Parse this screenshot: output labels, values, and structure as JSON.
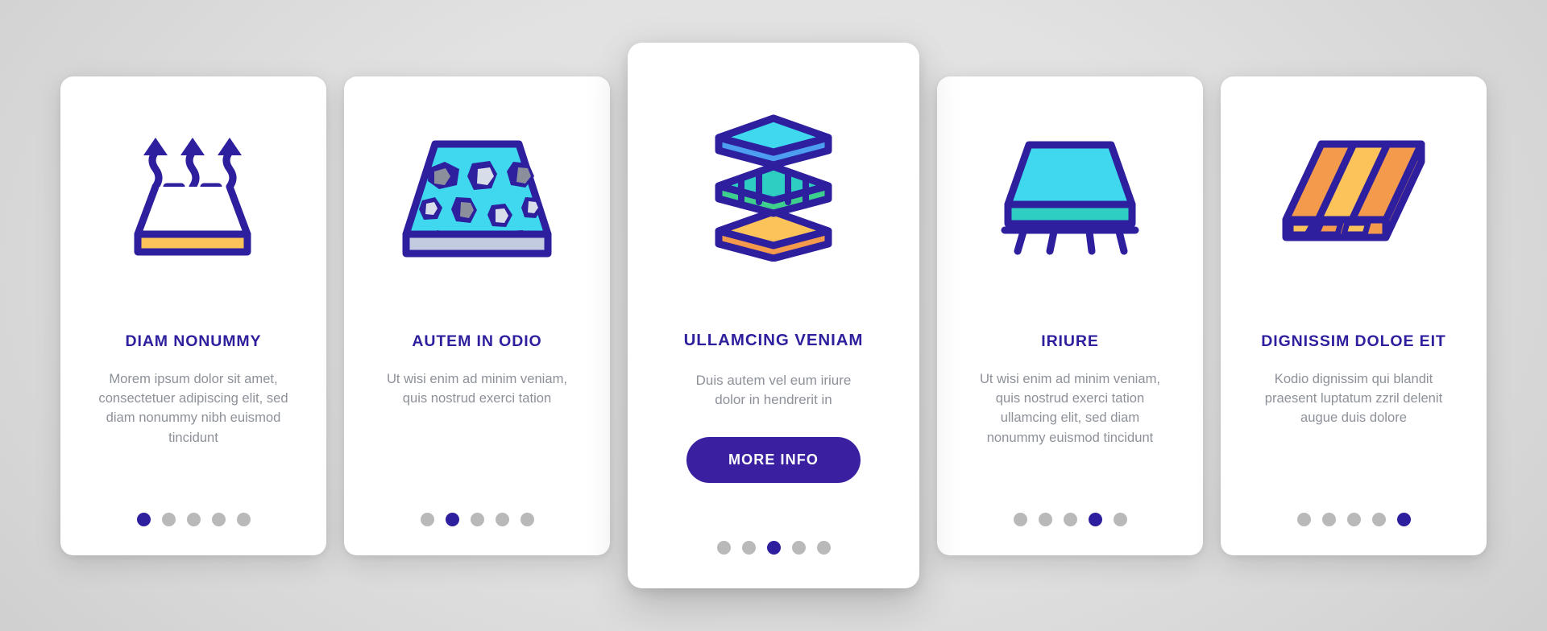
{
  "theme": {
    "accent_purple": "#2d1f9e",
    "button_purple": "#3a1fa0",
    "cyan": "#3fd8ef",
    "teal": "#2ecfc2",
    "green": "#3ccf8e",
    "blue": "#4d9ef0",
    "orange": "#f49a4c",
    "yellow": "#fcc35a",
    "gray_text": "#8d9199",
    "dot_inactive": "#b9b9b9",
    "slab_gray": "#c3cbe0",
    "chip_gray": "#8a8f9b",
    "chip_light": "#d8ddea",
    "background": "#e2e2e2"
  },
  "cards": [
    {
      "id": "card-1",
      "icon_name": "breathable-slab-icon",
      "title": "DIAM NONUMMY",
      "body": "Morem ipsum dolor sit amet, consectetuer adipiscing elit, sed diam nonummy nibh euismod tincidunt",
      "dots": {
        "count": 5,
        "active_index": 0
      },
      "has_cta": false,
      "featured": false
    },
    {
      "id": "card-2",
      "icon_name": "terrazzo-slab-icon",
      "title": "AUTEM IN ODIO",
      "body": "Ut wisi enim ad minim veniam, quis nostrud exerci tation",
      "dots": {
        "count": 5,
        "active_index": 1
      },
      "has_cta": false,
      "featured": false
    },
    {
      "id": "card-3",
      "icon_name": "layered-stack-icon",
      "title": "ULLAMCING VENIAM",
      "body": "Duis autem vel eum iriure dolor in hendrerit in",
      "cta_label": "MORE INFO",
      "dots": {
        "count": 5,
        "active_index": 2
      },
      "has_cta": true,
      "featured": true
    },
    {
      "id": "card-4",
      "icon_name": "reinforced-slab-icon",
      "title": "IRIURE",
      "body": "Ut wisi enim ad minim veniam, quis nostrud exerci tation ullamcing elit, sed diam nonummy euismod tincidunt",
      "dots": {
        "count": 5,
        "active_index": 3
      },
      "has_cta": false,
      "featured": false
    },
    {
      "id": "card-5",
      "icon_name": "wood-plank-floor-icon",
      "title": "DIGNISSIM DOLOE EIT",
      "body": "Kodio dignissim qui blandit praesent luptatum zzril delenit augue duis dolore",
      "dots": {
        "count": 5,
        "active_index": 4
      },
      "has_cta": false,
      "featured": false
    }
  ]
}
